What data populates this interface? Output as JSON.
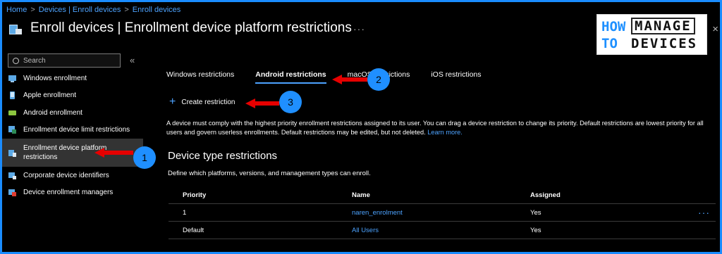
{
  "breadcrumb": [
    "Home",
    "Devices | Enroll devices",
    "Enroll devices"
  ],
  "header": {
    "title": "Enroll devices | Enrollment device platform restrictions",
    "more": "···",
    "close": "×"
  },
  "logo": {
    "how": "HOW",
    "to": "TO",
    "manage": "MANAGE",
    "devices": "DEVICES"
  },
  "search": {
    "placeholder": "Search",
    "collapse": "«"
  },
  "sidebar": {
    "items": [
      {
        "label": "Windows enrollment",
        "icon": "windows-icon"
      },
      {
        "label": "Apple enrollment",
        "icon": "apple-icon"
      },
      {
        "label": "Android enrollment",
        "icon": "android-icon"
      },
      {
        "label": "Enrollment device limit restrictions",
        "icon": "limit-icon"
      },
      {
        "label": "Enrollment device platform restrictions",
        "icon": "platform-icon"
      },
      {
        "label": "Corporate device identifiers",
        "icon": "corporate-icon"
      },
      {
        "label": "Device enrollment managers",
        "icon": "managers-icon"
      }
    ]
  },
  "tabs": [
    {
      "label": "Windows restrictions"
    },
    {
      "label": "Android restrictions"
    },
    {
      "label": "macOS restrictions"
    },
    {
      "label": "iOS restrictions"
    }
  ],
  "toolbar": {
    "create_label": "Create restriction"
  },
  "description": {
    "text": "A device must comply with the highest priority enrollment restrictions assigned to its user. You can drag a device restriction to change its priority. Default restrictions are lowest priority for all users and govern userless enrollments. Default restrictions may be edited, but not deleted.",
    "learn_more": "Learn more."
  },
  "section": {
    "title": "Device type restrictions",
    "subtitle": "Define which platforms, versions, and management types can enroll."
  },
  "table": {
    "headers": [
      "Priority",
      "Name",
      "Assigned"
    ],
    "rows": [
      {
        "priority": "1",
        "name": "naren_enrolment",
        "assigned": "Yes",
        "more": "···"
      },
      {
        "priority": "Default",
        "name": "All Users",
        "assigned": "Yes"
      }
    ]
  },
  "annotations": [
    "1",
    "2",
    "3"
  ],
  "colors": {
    "accent": "#4da3ff",
    "arrow": "#e60000",
    "marker": "#1f8fff",
    "frame": "#1a8cff"
  }
}
